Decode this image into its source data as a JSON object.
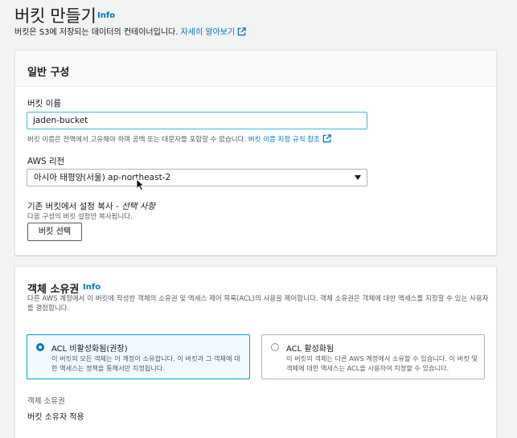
{
  "header": {
    "title": "버킷 만들기",
    "info_label": "Info",
    "description": "버킷은 S3에 저장되는 데이터의 컨테이너입니다.",
    "learn_more_link": "자세히 알아보기"
  },
  "general": {
    "title": "일반 구성",
    "bucket_name": {
      "label": "버킷 이름",
      "value": "jaden-bucket",
      "hint": "버킷 이름은 전역에서 고유해야 하며 공백 또는 대문자를 포함할 수 없습니다.",
      "hint_link": "버킷 이름 지정 규칙 참조"
    },
    "region": {
      "label": "AWS 리전",
      "selected": "아시아 태평양(서울) ap-northeast-2"
    },
    "copy_settings": {
      "label": "기존 버킷에서 설정 복사 - ",
      "label_optional": "선택 사항",
      "hint": "다음 구성의 버킷 설정만 복사됩니다.",
      "button_label": "버킷 선택"
    }
  },
  "object_ownership": {
    "title": "객체 소유권",
    "info_label": "Info",
    "description": "다른 AWS 계정에서 이 버킷에 작성한 객체의 소유권 및 액세스 제어 목록(ACL)의 사용을 제어합니다. 객체 소유권은 객체에 대한 액세스를 지정할 수 있는 사용자를 결정합니다.",
    "options": [
      {
        "title": "ACL 비활성화됨(권장)",
        "description": "이 버킷의 모든 객체는 이 계정이 소유합니다. 이 버킷과 그 객체에 대한 액세스는 정책을 통해서만 지정됩니다.",
        "selected": true
      },
      {
        "title": "ACL 활성화됨",
        "description": "이 버킷의 객체는 다른 AWS 계정에서 소유할 수 있습니다. 이 버킷 및 객체에 대한 액세스는 ACL을 사용하여 지정할 수 있습니다.",
        "selected": false
      }
    ],
    "ownership_label": "객체 소유권",
    "ownership_value": "버킷 소유자 적용"
  },
  "icons": {
    "external_link": "external-link-icon",
    "dropdown": "caret-down-icon",
    "cursor": "mouse-pointer-icon"
  },
  "colors": {
    "link": "#0073bb",
    "focus_border": "#44b9d6",
    "selected_tile_bg": "#f1faff",
    "selected_tile_border": "#00a1c9"
  }
}
